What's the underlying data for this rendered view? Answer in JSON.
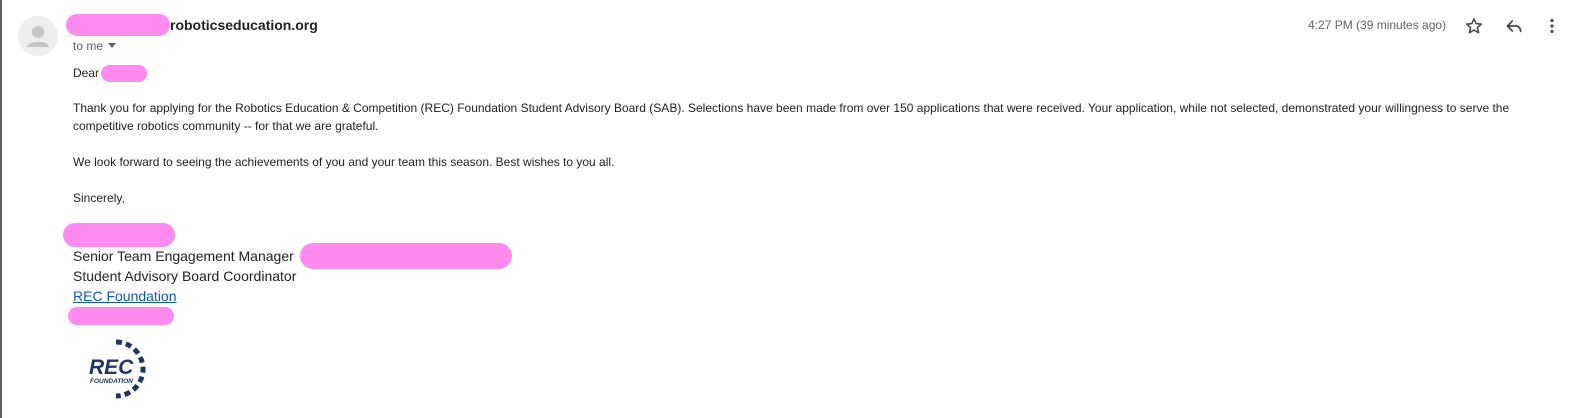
{
  "header": {
    "sender_domain": "roboticseducation.org",
    "to_label": "to me",
    "timestamp": "4:27 PM (39 minutes ago)",
    "icons": [
      "person-avatar-icon",
      "chevron-down-icon",
      "star-icon",
      "reply-icon",
      "more-vert-icon"
    ]
  },
  "message": {
    "greeting": "Dear",
    "paragraph1": "Thank you for applying for the Robotics Education & Competition (REC) Foundation Student Advisory Board (SAB).  Selections have been made from over 150 applications that were received.  Your application, while not selected, demonstrated your willingness to serve the competitive robotics community -- for that we are grateful.",
    "paragraph2": "We look forward to seeing the achievements of you and your team this season.  Best wishes to you all.",
    "closing": "Sincerely,"
  },
  "signature": {
    "title": "Senior Team Engagement Manager",
    "role": "Student Advisory Board Coordinator",
    "link_text": "REC Foundation",
    "phone_partial": "(",
    "logo_text_main": "REC",
    "logo_text_sub": "FOUNDATION"
  },
  "colors": {
    "accent_link": "#1155cc",
    "redaction": "#ff8af0",
    "logo_navy": "#1f3563"
  }
}
